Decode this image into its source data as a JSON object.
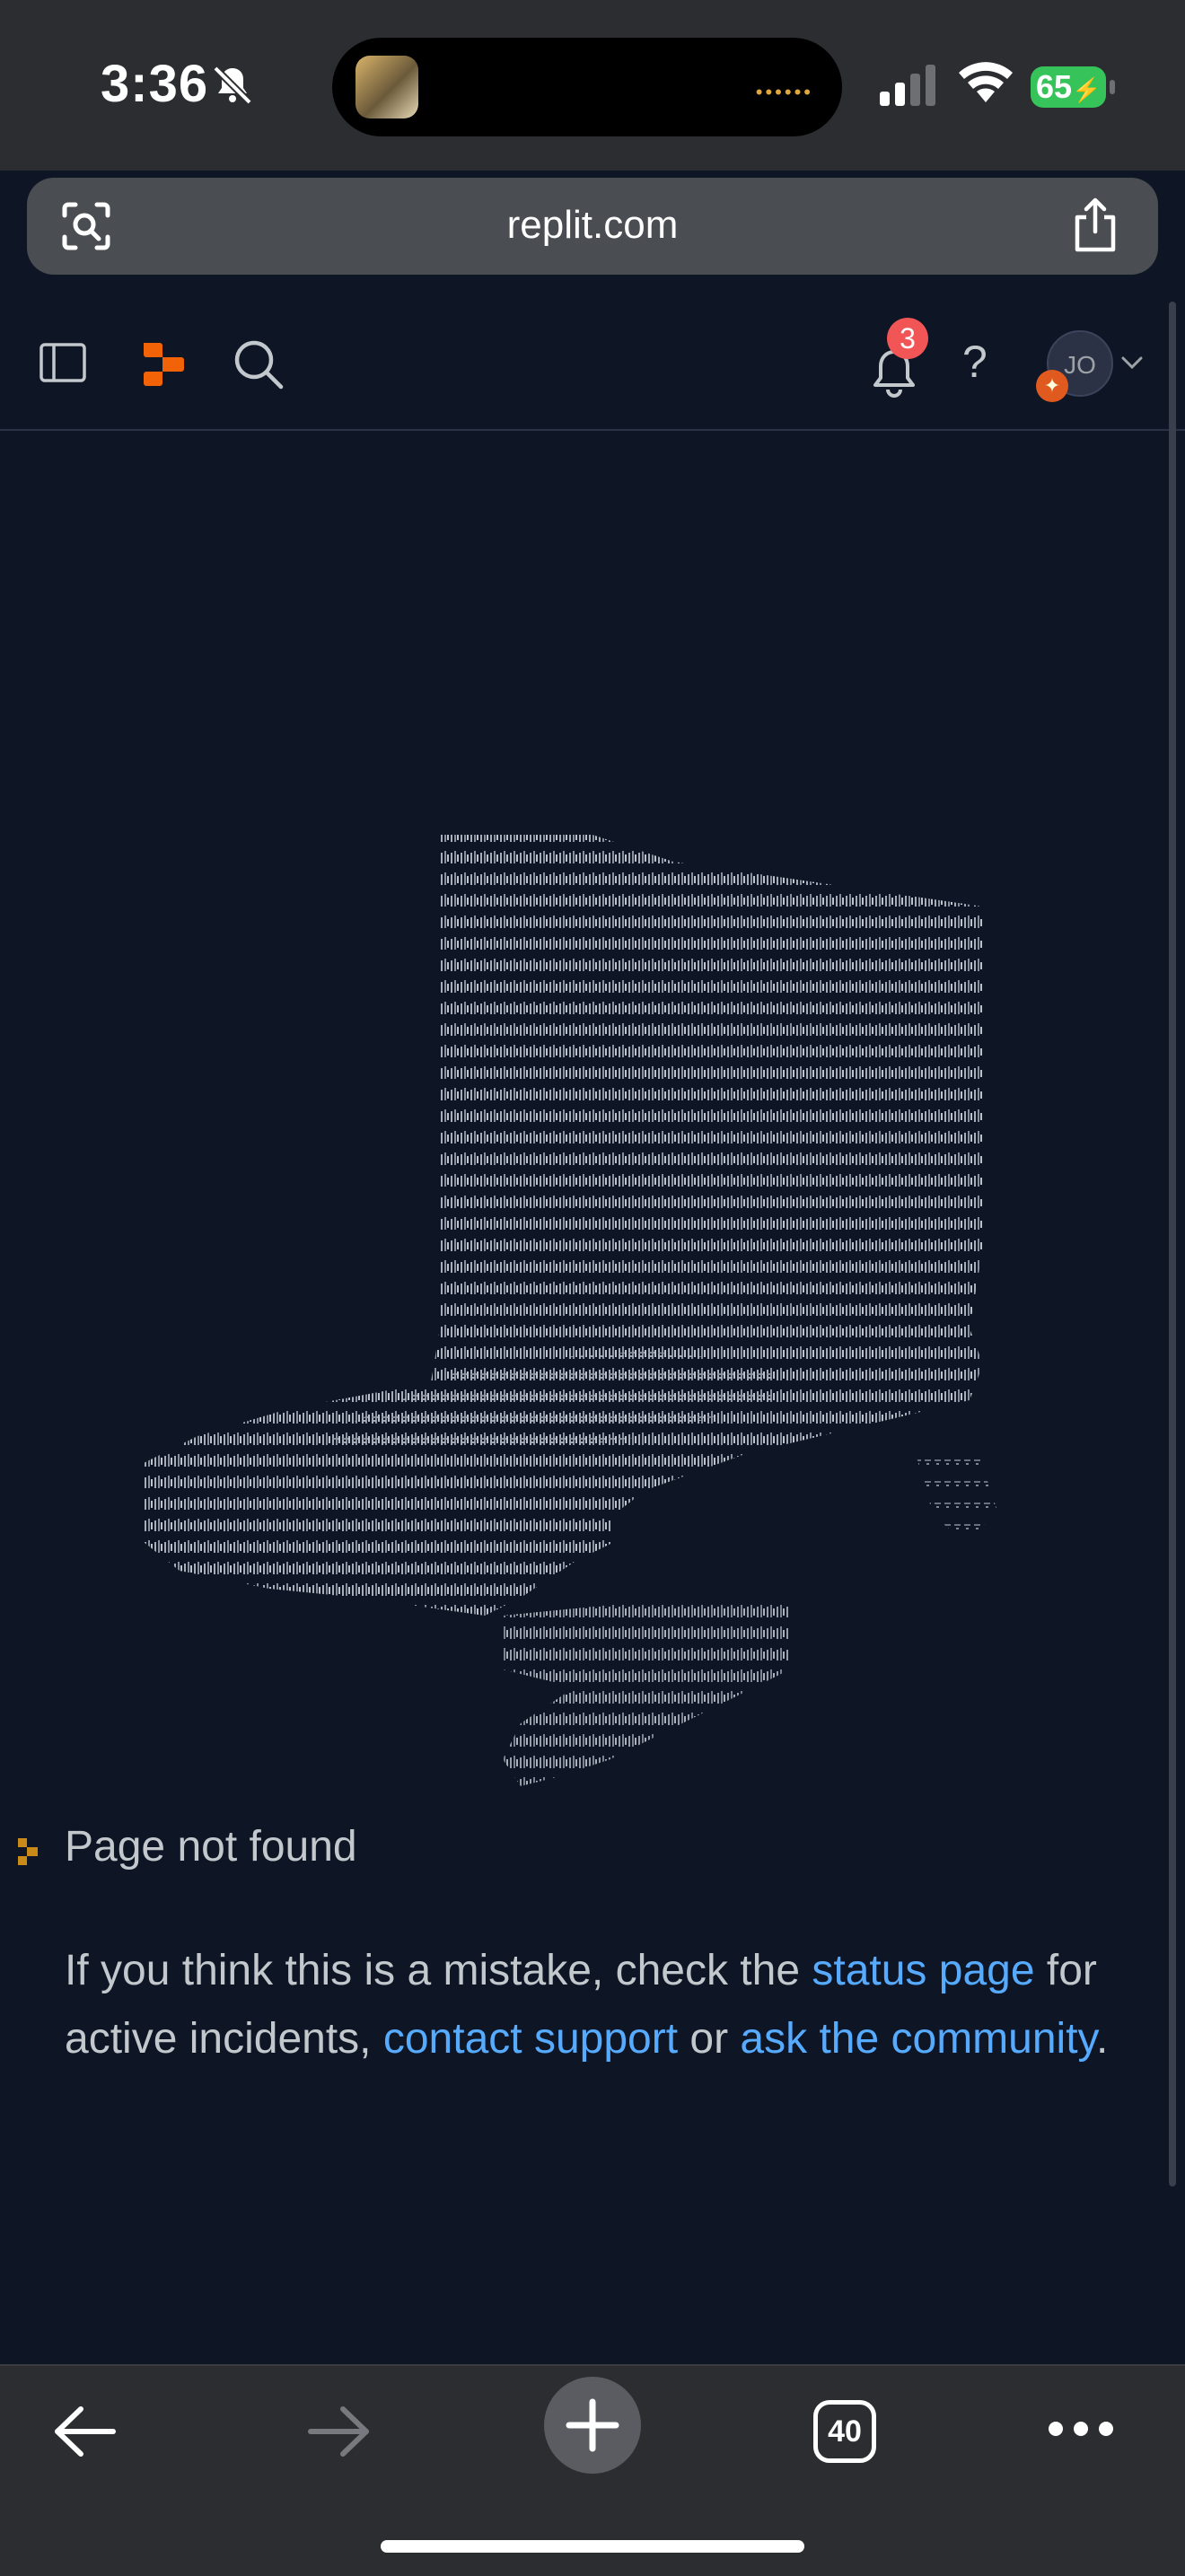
{
  "status_bar": {
    "time": "3:36",
    "battery": "65"
  },
  "browser": {
    "url": "replit.com"
  },
  "topnav": {
    "notification_count": "3",
    "help": "?",
    "avatar_initials": "JO"
  },
  "error": {
    "title": "Page not found",
    "msg_part1": "If you think this is a mistake, check the ",
    "status_link": "status page",
    "msg_part2": " for active incidents, ",
    "support_link": "contact support",
    "msg_part3": " or ",
    "community_link": "ask the community",
    "msg_part4": "."
  },
  "toolbar": {
    "tab_count": "40"
  },
  "colors": {
    "page_bg": "#0e1525",
    "link": "#57abff",
    "brand_orange": "#f26207",
    "badge_red": "#f25555"
  }
}
